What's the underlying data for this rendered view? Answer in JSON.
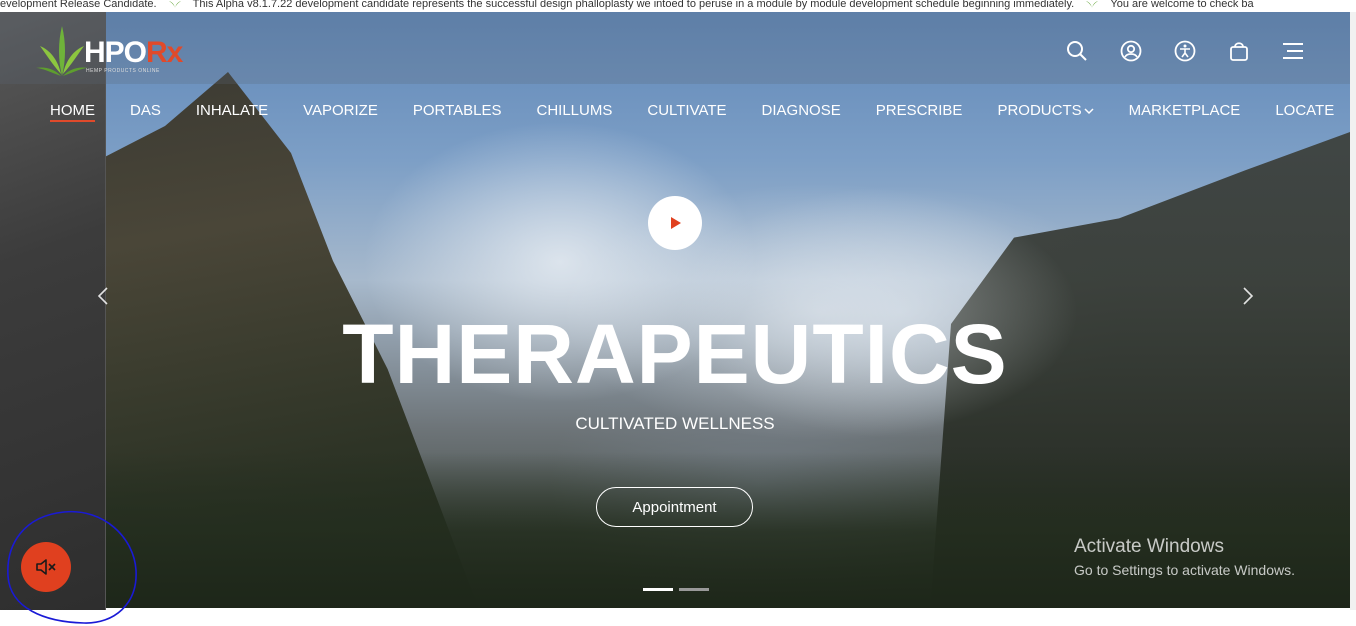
{
  "ticker": {
    "part1": "evelopment Release Candidate.",
    "part2": "This Alpha v8.1.7.22 development candidate represents the successful design phalloplasty we intoed to peruse in a module by module development schedule beginning immediately.",
    "part3": "You are welcome to check ba"
  },
  "header": {
    "logo_text": "HPO",
    "logo_rx": "Rx",
    "logo_sub": "HEMP PRODUCTS ONLINE",
    "icons": [
      "search-icon",
      "user-icon",
      "accessibility-icon",
      "shopping-bag-icon",
      "menu-icon"
    ]
  },
  "nav": {
    "items": [
      "HOME",
      "DAS",
      "INHALATE",
      "VAPORIZE",
      "PORTABLES",
      "CHILLUMS",
      "CULTIVATE",
      "DIAGNOSE",
      "PRESCRIBE",
      "PRODUCTS",
      "MARKETPLACE",
      "LOCATE"
    ],
    "active": "HOME"
  },
  "hero": {
    "title": "THERAPEUTICS",
    "subtitle": "CULTIVATED WELLNESS",
    "cta": "Appointment",
    "slide_current": 1,
    "slide_total": 2
  },
  "watermark": {
    "title": "Activate Windows",
    "subtitle": "Go to Settings to activate Windows."
  },
  "colors": {
    "accent": "#e04a2b",
    "mute_button": "#e0401f",
    "annotation_ring": "#1a1ad6"
  }
}
